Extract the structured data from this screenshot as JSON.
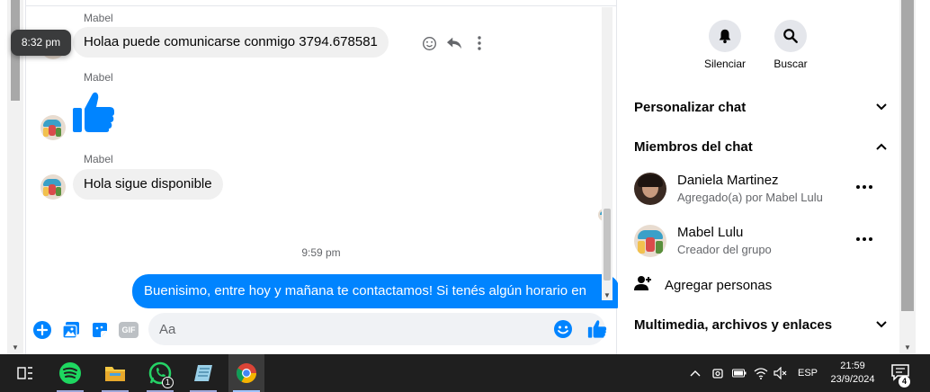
{
  "messages": [
    {
      "sender": "Mabel",
      "text": "Holaa puede comunicarse conmigo 3794.678581",
      "tooltip_time": "8:32 pm"
    },
    {
      "sender": "Mabel",
      "sticker": "thumbs-up"
    },
    {
      "sender": "Mabel",
      "text": "Hola sigue disponible"
    }
  ],
  "timestamp": "9:59 pm",
  "sent_message": "Buenisimo, entre hoy y mañana te contactamos! Si tenés algún horario en",
  "composer": {
    "placeholder": "Aa",
    "gif_label": "GIF"
  },
  "right_panel": {
    "actions": [
      {
        "label": "Silenciar",
        "icon": "bell-icon"
      },
      {
        "label": "Buscar",
        "icon": "search-icon"
      }
    ],
    "sections": {
      "customize": "Personalizar chat",
      "members": "Miembros del chat",
      "media": "Multimedia, archivos y enlaces"
    },
    "members": [
      {
        "name": "Daniela Martinez",
        "subtitle": "Agregado(a) por Mabel Lulu"
      },
      {
        "name": "Mabel Lulu",
        "subtitle": "Creador del grupo"
      }
    ],
    "add_people": "Agregar personas"
  },
  "taskbar": {
    "whatsapp_badge": "1",
    "lang": "ESP",
    "time": "21:59",
    "date": "23/9/2024",
    "notifications": "4"
  },
  "colors": {
    "messenger_blue": "#0084ff",
    "bubble_gray": "#f0f0f0",
    "taskbar": "#1f1f1f"
  }
}
